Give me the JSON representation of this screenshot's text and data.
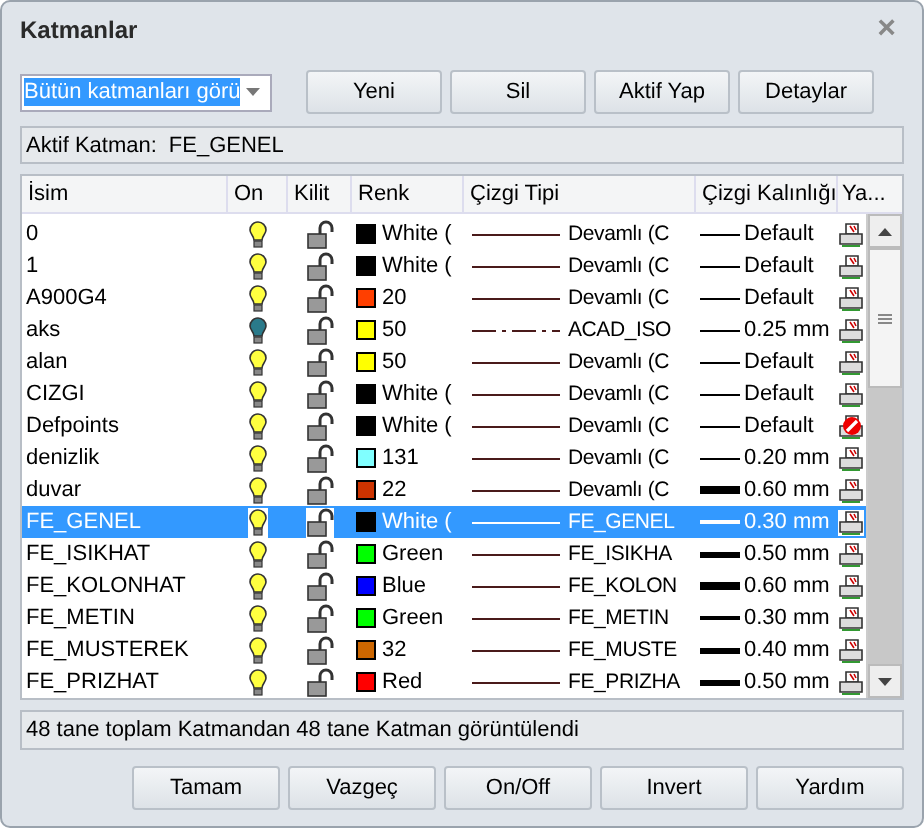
{
  "window": {
    "title": "Katmanlar",
    "close": "×"
  },
  "filter": {
    "value": "Bütün katmanları görü"
  },
  "toolbar": [
    "Yeni",
    "Sil",
    "Aktif Yap",
    "Detaylar"
  ],
  "active_layer": {
    "label": "Aktif Katman:",
    "value": "FE_GENEL"
  },
  "table": {
    "columns": [
      "İsim",
      "On",
      "Kilit",
      "Renk",
      "Çizgi Tipi",
      "Çizgi Kalınlığı",
      "Ya..."
    ],
    "rows": [
      {
        "name": "0",
        "on": true,
        "locked": false,
        "color": "#000000",
        "color_label": "White (",
        "linetype_sample": {
          "kind": "solid"
        },
        "linetype": "Devamlı (C",
        "weight_sample": {
          "kind": "hair"
        },
        "lineweight": "Default",
        "plot": true,
        "selected": false
      },
      {
        "name": "1",
        "on": true,
        "locked": false,
        "color": "#000000",
        "color_label": "White (",
        "linetype_sample": {
          "kind": "solid"
        },
        "linetype": "Devamlı (C",
        "weight_sample": {
          "kind": "hair"
        },
        "lineweight": "Default",
        "plot": true,
        "selected": false
      },
      {
        "name": "A900G4",
        "on": true,
        "locked": false,
        "color": "#ff3f00",
        "color_label": "20",
        "linetype_sample": {
          "kind": "solid"
        },
        "linetype": "Devamlı (C",
        "weight_sample": {
          "kind": "hair"
        },
        "lineweight": "Default",
        "plot": true,
        "selected": false
      },
      {
        "name": "aks",
        "on": false,
        "locked": false,
        "color": "#ffff00",
        "color_label": "50",
        "linetype_sample": {
          "kind": "dashdot"
        },
        "linetype": "ACAD_ISO",
        "weight_sample": {
          "kind": "hair"
        },
        "lineweight": "0.25 mm",
        "plot": true,
        "selected": false
      },
      {
        "name": "alan",
        "on": true,
        "locked": false,
        "color": "#ffff00",
        "color_label": "50",
        "linetype_sample": {
          "kind": "solid"
        },
        "linetype": "Devamlı (C",
        "weight_sample": {
          "kind": "hair"
        },
        "lineweight": "Default",
        "plot": true,
        "selected": false
      },
      {
        "name": "CIZGI",
        "on": true,
        "locked": false,
        "color": "#000000",
        "color_label": "White (",
        "linetype_sample": {
          "kind": "solid"
        },
        "linetype": "Devamlı (C",
        "weight_sample": {
          "kind": "hair"
        },
        "lineweight": "Default",
        "plot": true,
        "selected": false
      },
      {
        "name": "Defpoints",
        "on": true,
        "locked": false,
        "color": "#000000",
        "color_label": "White (",
        "linetype_sample": {
          "kind": "solid"
        },
        "linetype": "Devamlı (C",
        "weight_sample": {
          "kind": "hair"
        },
        "lineweight": "Default",
        "plot": false,
        "selected": false
      },
      {
        "name": "denizlik",
        "on": true,
        "locked": false,
        "color": "#80ffff",
        "color_label": "131",
        "linetype_sample": {
          "kind": "solid"
        },
        "linetype": "Devamlı (C",
        "weight_sample": {
          "kind": "hair"
        },
        "lineweight": "0.20 mm",
        "plot": true,
        "selected": false
      },
      {
        "name": "duvar",
        "on": true,
        "locked": false,
        "color": "#cc3300",
        "color_label": "22",
        "linetype_sample": {
          "kind": "solid"
        },
        "linetype": "Devamlı (C",
        "weight_sample": {
          "kind": "thick"
        },
        "lineweight": "0.60 mm",
        "plot": true,
        "selected": false
      },
      {
        "name": "FE_GENEL",
        "on": true,
        "locked": false,
        "color": "#000000",
        "color_label": "White (",
        "linetype_sample": {
          "kind": "solid"
        },
        "linetype": "FE_GENEL",
        "weight_sample": {
          "kind": "thin"
        },
        "lineweight": "0.30 mm",
        "plot": true,
        "selected": true
      },
      {
        "name": "FE_ISIKHAT",
        "on": true,
        "locked": false,
        "color": "#00ff00",
        "color_label": "Green",
        "linetype_sample": {
          "kind": "solid"
        },
        "linetype": "FE_ISIKHA",
        "weight_sample": {
          "kind": "medium"
        },
        "lineweight": "0.50 mm",
        "plot": true,
        "selected": false
      },
      {
        "name": "FE_KOLONHAT",
        "on": true,
        "locked": false,
        "color": "#0000ff",
        "color_label": "Blue",
        "linetype_sample": {
          "kind": "solid"
        },
        "linetype": "FE_KOLON",
        "weight_sample": {
          "kind": "thick"
        },
        "lineweight": "0.60 mm",
        "plot": true,
        "selected": false
      },
      {
        "name": "FE_METIN",
        "on": true,
        "locked": false,
        "color": "#00ff00",
        "color_label": "Green",
        "linetype_sample": {
          "kind": "solid"
        },
        "linetype": "FE_METIN",
        "weight_sample": {
          "kind": "thin"
        },
        "lineweight": "0.30 mm",
        "plot": true,
        "selected": false
      },
      {
        "name": "FE_MUSTEREK",
        "on": true,
        "locked": false,
        "color": "#cc6600",
        "color_label": "32",
        "linetype_sample": {
          "kind": "solid"
        },
        "linetype": "FE_MUSTE",
        "weight_sample": {
          "kind": "medium"
        },
        "lineweight": "0.40 mm",
        "plot": true,
        "selected": false
      },
      {
        "name": "FE_PRIZHAT",
        "on": true,
        "locked": false,
        "color": "#ff0000",
        "color_label": "Red",
        "linetype_sample": {
          "kind": "solid"
        },
        "linetype": "FE_PRIZHA",
        "weight_sample": {
          "kind": "medium"
        },
        "lineweight": "0.50 mm",
        "plot": true,
        "selected": false
      }
    ]
  },
  "status_bar": "48 tane toplam Katmandan 48 tane Katman görüntülendi",
  "buttons": [
    "Tamam",
    "Vazgeç",
    "On/Off",
    "Invert",
    "Yardım"
  ]
}
